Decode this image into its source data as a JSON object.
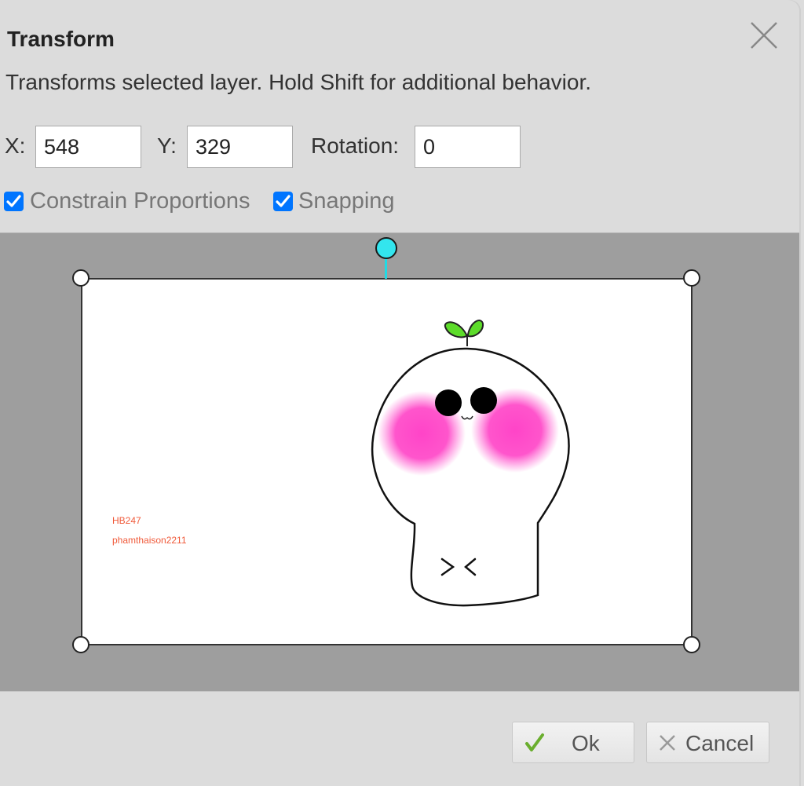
{
  "dialog": {
    "title": "Transform",
    "description": "Transforms selected layer. Hold Shift for additional behavior.",
    "close_icon": "close-icon"
  },
  "fields": {
    "x_label": "X:",
    "x_value": "548",
    "y_label": "Y:",
    "y_value": "329",
    "rotation_label": "Rotation:",
    "rotation_value": "0"
  },
  "options": {
    "constrain_label": "Constrain Proportions",
    "constrain_checked": true,
    "snapping_label": "Snapping",
    "snapping_checked": true
  },
  "preview": {
    "watermark_line1": "HB247",
    "watermark_line2": "phamthaison2211",
    "rotation_handle_color": "#33e5ee",
    "canvas_bg": "#9e9e9e",
    "blush_color": "#ff55cc",
    "sprout_color": "#55dd22"
  },
  "buttons": {
    "ok_label": "Ok",
    "ok_icon": "checkmark-icon",
    "cancel_label": "Cancel",
    "cancel_icon": "x-icon"
  }
}
